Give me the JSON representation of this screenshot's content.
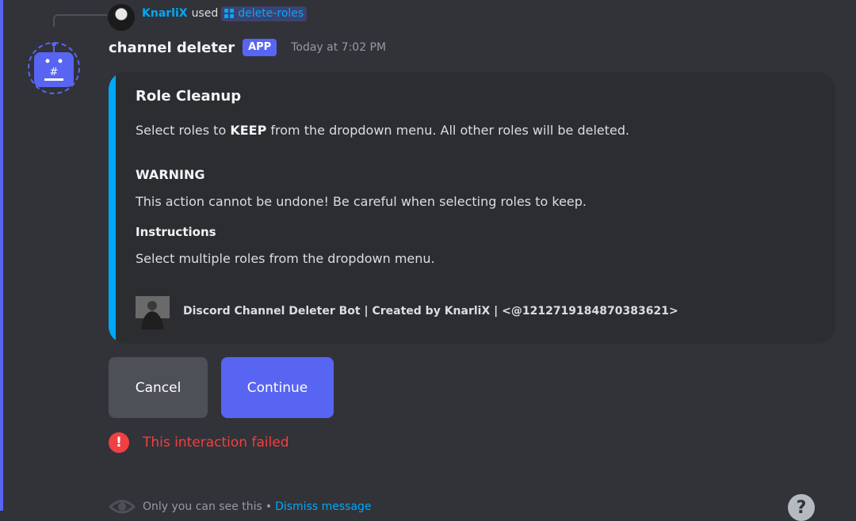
{
  "reply": {
    "user": "KnarliX",
    "used": "used",
    "command": "delete-roles"
  },
  "message": {
    "bot_name": "channel deleter",
    "badge": "APP",
    "timestamp": "Today at 7:02 PM"
  },
  "embed": {
    "title": "Role Cleanup",
    "desc_before": "Select roles to ",
    "desc_bold": "KEEP",
    "desc_after": " from the dropdown menu. All other roles will be deleted.",
    "warning_title": "WARNING",
    "warning_text": "This action cannot be undone! Be careful when selecting roles to keep.",
    "field_name": "Instructions",
    "field_value": "Select multiple roles from the dropdown menu.",
    "footer": "Discord Channel Deleter Bot | Created by KnarliX | <@1212719184870383621>"
  },
  "buttons": {
    "cancel": "Cancel",
    "continue": "Continue"
  },
  "failure": {
    "icon": "!",
    "text": "This interaction failed"
  },
  "ephemeral": {
    "text": "Only you can see this",
    "sep": "•",
    "dismiss": "Dismiss message"
  },
  "help": {
    "icon": "?"
  },
  "colors": {
    "accent": "#5865f2",
    "link": "#00a8fc",
    "danger": "#f23f43",
    "background": "#313338",
    "embed_bg": "#2b2d31"
  },
  "icons": {
    "command": "grid-icon",
    "bot_avatar": "robot-icon",
    "failure": "alert-icon",
    "ephemeral": "eye-icon",
    "help": "help-icon"
  }
}
